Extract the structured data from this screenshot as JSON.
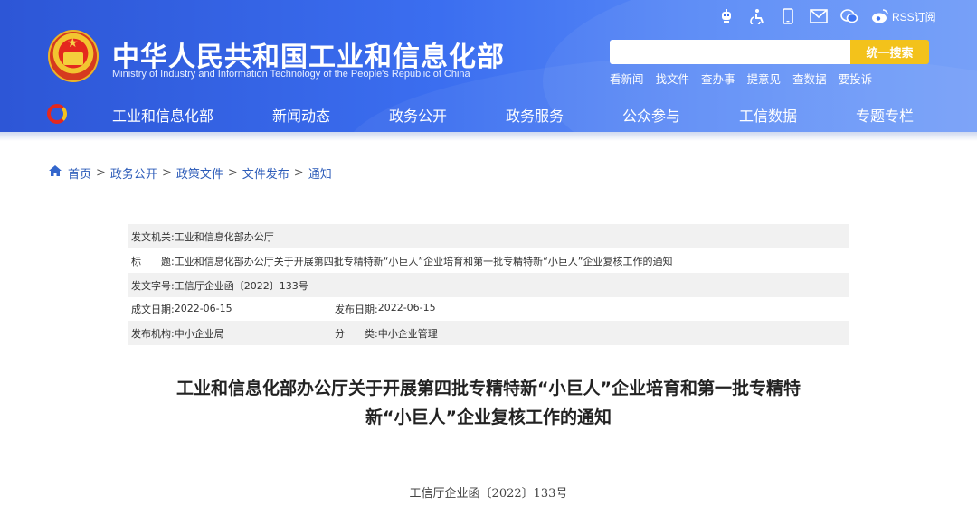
{
  "header": {
    "site_title": "中华人民共和国工业和信息化部",
    "site_subtitle": "Ministry of Industry and Information Technology of the People's Republic of China",
    "top_icons": [
      "robot-icon",
      "accessibility-icon",
      "mobile-icon",
      "mail-icon",
      "wechat-icon",
      "weibo-icon"
    ],
    "rss_label": "RSS订阅",
    "search": {
      "value": "",
      "placeholder": "",
      "button_label": "统一搜索"
    },
    "quick_links": [
      "看新闻",
      "找文件",
      "查办事",
      "提意见",
      "查数据",
      "要投诉"
    ],
    "nav": [
      "工业和信息化部",
      "新闻动态",
      "政务公开",
      "政务服务",
      "公众参与",
      "工信数据",
      "专题专栏"
    ]
  },
  "breadcrumb": [
    "首页",
    "政务公开",
    "政策文件",
    "文件发布",
    "通知"
  ],
  "meta": {
    "issuer_label": "发文机关:",
    "issuer": "工业和信息化部办公厅",
    "title_label": "标　　题:",
    "title": "工业和信息化部办公厅关于开展第四批专精特新“小巨人”企业培育和第一批专精特新“小巨人”企业复核工作的通知",
    "docno_label": "发文字号:",
    "docno": "工信厅企业函〔2022〕133号",
    "created_label": "成文日期:",
    "created": "2022-06-15",
    "published_label": "发布日期:",
    "published": "2022-06-15",
    "agency_label": "发布机构:",
    "agency": "中小企业局",
    "category_label": "分　　类:",
    "category": "中小企业管理"
  },
  "article": {
    "title_line1": "工业和信息化部办公厅关于开展第四批专精特新“小巨人”企业培育和第一批专精特",
    "title_line2": "新“小巨人”企业复核工作的通知",
    "doc_number": "工信厅企业函〔2022〕133号"
  },
  "colors": {
    "header_blue": "#3b6ef0",
    "search_yellow": "#f3c21b",
    "breadcrumb_blue": "#2a5ab8",
    "meta_shade": "#f1f1f1"
  }
}
